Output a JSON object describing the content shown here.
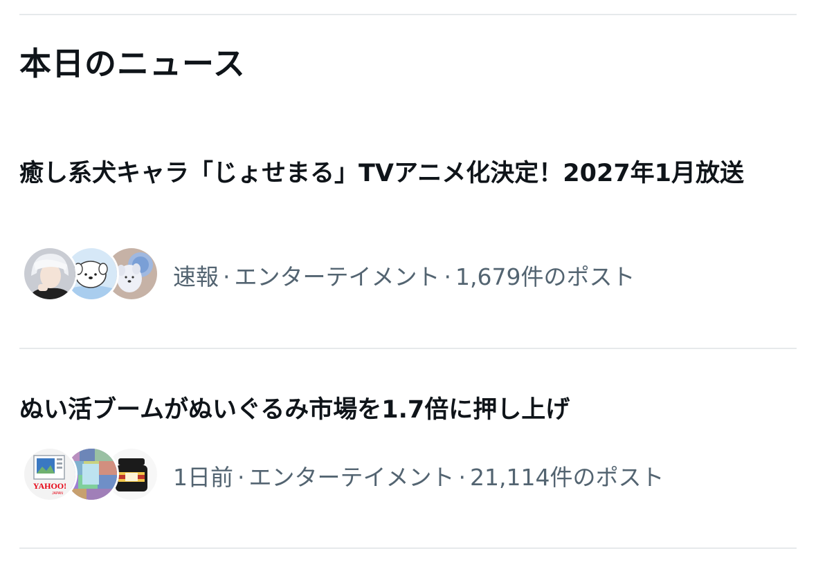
{
  "section": {
    "title": "本日のニュース"
  },
  "news": [
    {
      "headline": "癒し系犬キャラ「じょせまる」TVアニメ化決定！2027年1月放送",
      "time": "速報",
      "category": "エンターテイメント",
      "posts": "1,679件のポスト",
      "avatars": [
        "person-avatar",
        "dog-character-avatar",
        "plush-dog-avatar"
      ]
    },
    {
      "headline": "ぬい活ブームがぬいぐるみ市場を1.7倍に押し上げ",
      "time": "1日前",
      "category": "エンターテイメント",
      "posts": "21,114件のポスト",
      "avatars": [
        "yahoo-japan-news-avatar",
        "mosaic-art-avatar",
        "ink-bottle-avatar"
      ],
      "avatar_texts": [
        "YAHOO!",
        "JAPAN"
      ]
    }
  ],
  "separator": "·",
  "colors": {
    "text": "#0f1419",
    "meta": "#536471",
    "divider": "#e6e9eb"
  }
}
